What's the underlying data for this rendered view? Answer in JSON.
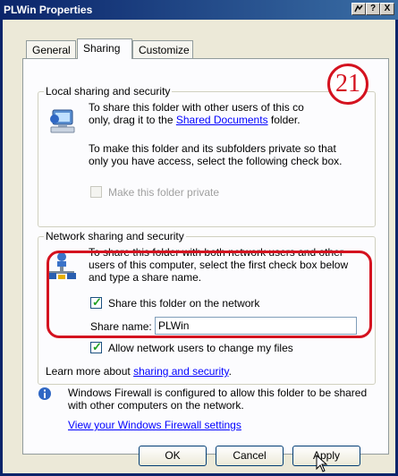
{
  "window": {
    "title": "PLWin Properties"
  },
  "titlebar_buttons": {
    "help": "?",
    "close": "X"
  },
  "tabs": [
    {
      "label": "General"
    },
    {
      "label": "Sharing"
    },
    {
      "label": "Customize"
    }
  ],
  "local_group": {
    "title": "Local sharing and security",
    "text_line1": "To share this folder with other users of this co",
    "text_line2_before": "only, drag it to the ",
    "link": "Shared Documents",
    "text_line2_after": " folder.",
    "text2_line1": "To make this folder and its subfolders private so that",
    "text2_line2": "only you have access, select the following check box.",
    "private_checkbox_label": "Make this folder private"
  },
  "network_group": {
    "title": "Network sharing and security",
    "text_line1": "To share this folder with both network users and other",
    "text_line2": "users of this computer, select the first check box below",
    "text_line3": "and type a share name.",
    "share_checkbox_label": "Share this folder on the network",
    "share_name_label": "Share name:",
    "share_name_value": "PLWin",
    "allow_change_label": "Allow network users to change my files",
    "learn_before": "Learn more about ",
    "learn_link": "sharing and security",
    "learn_after": "."
  },
  "firewall": {
    "line1": "Windows Firewall is configured to allow this folder to be shared",
    "line2": "with other computers on the network.",
    "link": "View your Windows Firewall settings"
  },
  "buttons": {
    "ok": "OK",
    "cancel": "Cancel",
    "apply": "Apply"
  },
  "annotation": {
    "number": "21",
    "color": "#d4121f"
  }
}
